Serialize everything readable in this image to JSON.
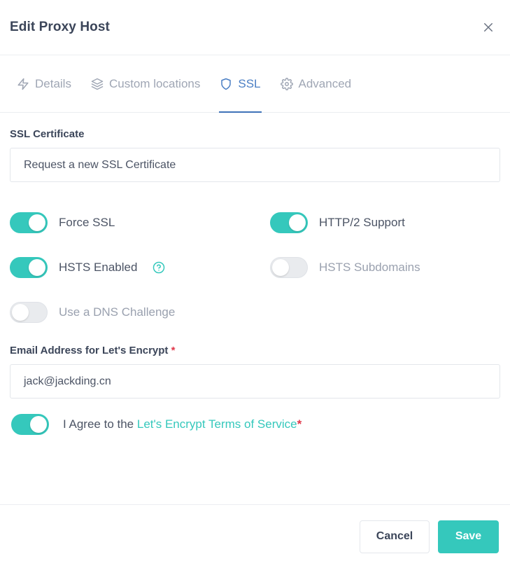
{
  "header": {
    "title": "Edit Proxy Host",
    "close_icon": "close-icon"
  },
  "tabs": [
    {
      "label": "Details",
      "icon": "zap-icon",
      "active": false
    },
    {
      "label": "Custom locations",
      "icon": "layers-icon",
      "active": false
    },
    {
      "label": "SSL",
      "icon": "shield-icon",
      "active": true
    },
    {
      "label": "Advanced",
      "icon": "gear-icon",
      "active": false
    }
  ],
  "ssl_certificate": {
    "label": "SSL Certificate",
    "value": "Request a new SSL Certificate"
  },
  "toggles": [
    {
      "id": "force-ssl",
      "label": "Force SSL",
      "on": true,
      "disabled": false,
      "help": false
    },
    {
      "id": "http2-support",
      "label": "HTTP/2 Support",
      "on": true,
      "disabled": false,
      "help": false
    },
    {
      "id": "hsts-enabled",
      "label": "HSTS Enabled",
      "on": true,
      "disabled": false,
      "help": true
    },
    {
      "id": "hsts-subdomains",
      "label": "HSTS Subdomains",
      "on": false,
      "disabled": true,
      "help": false
    },
    {
      "id": "dns-challenge",
      "label": "Use a DNS Challenge",
      "on": false,
      "disabled": true,
      "help": false
    }
  ],
  "email": {
    "label": "Email Address for Let's Encrypt",
    "required_marker": "*",
    "value": "jack@jackding.cn",
    "placeholder": ""
  },
  "agree": {
    "toggle_on": true,
    "prefix": "I Agree to the ",
    "link_text": "Let's Encrypt Terms of Service",
    "required_marker": "*"
  },
  "footer": {
    "cancel_label": "Cancel",
    "save_label": "Save"
  },
  "colors": {
    "accent_teal": "#35c8bc",
    "tab_active_blue": "#4a7ec4",
    "required_red": "#e0384a",
    "text_dark": "#3b4559",
    "text_muted": "#9aa1af"
  }
}
